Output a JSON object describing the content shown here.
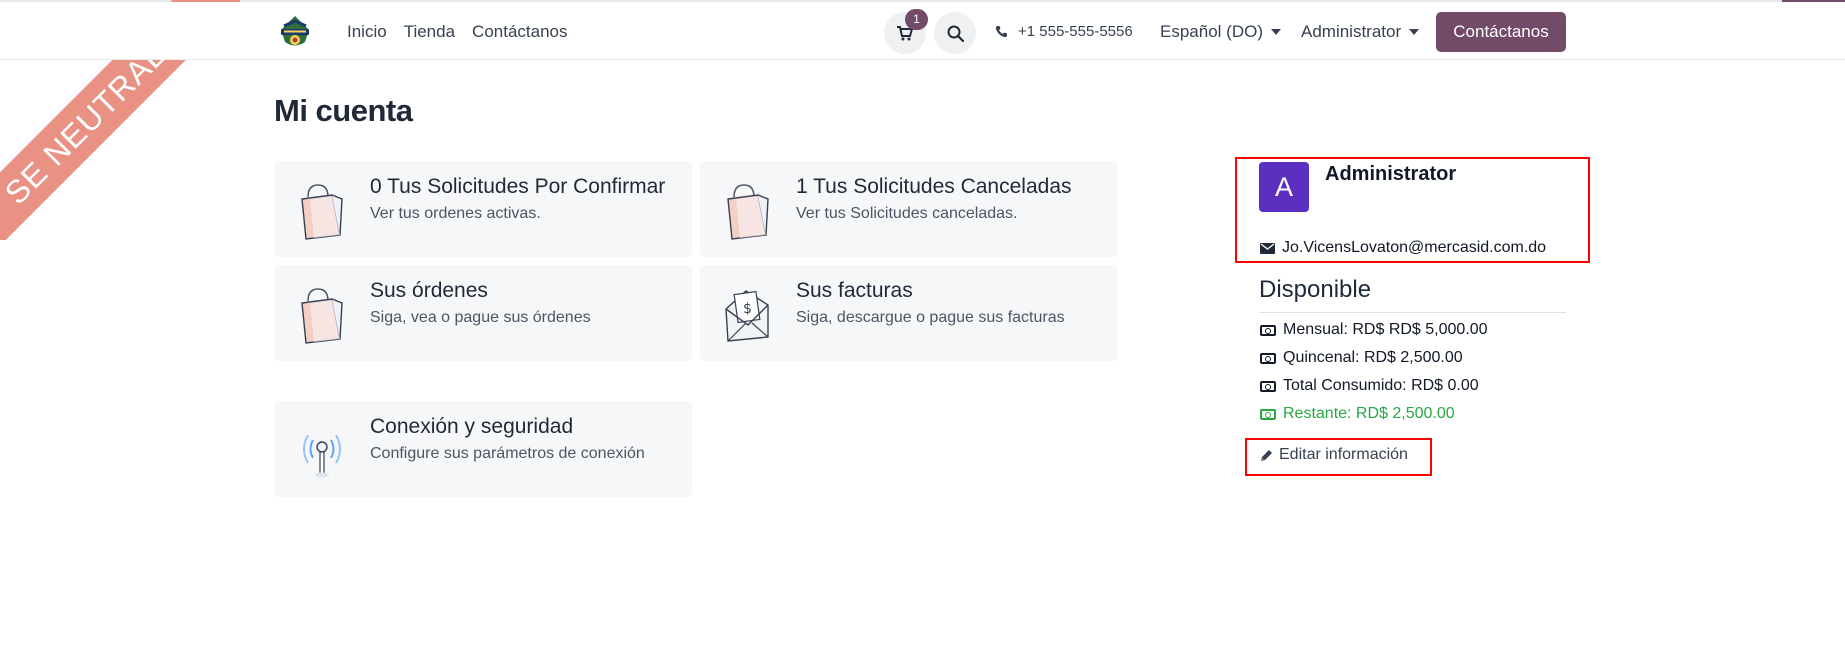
{
  "ribbon": {
    "text": "SE NEUTRALIZÓ"
  },
  "header": {
    "nav": [
      "Inicio",
      "Tienda",
      "Contáctanos"
    ],
    "cart_count": "1",
    "phone": "+1 555-555-5556",
    "language": "Español (DO)",
    "user": "Administrator",
    "cta": "Contáctanos"
  },
  "page": {
    "title": "Mi cuenta"
  },
  "cards": [
    {
      "title": "0  Tus Solicitudes Por Confirmar",
      "subtitle": "Ver tus ordenes activas.",
      "icon": "shopping-bag-icon"
    },
    {
      "title": "1 Tus Solicitudes Canceladas",
      "subtitle": "Ver tus Solicitudes canceladas.",
      "icon": "shopping-bag-icon"
    },
    {
      "title": "Sus órdenes",
      "subtitle": "Siga, vea o pague sus órdenes",
      "icon": "shopping-bag-icon"
    },
    {
      "title": "Sus facturas",
      "subtitle": "Siga, descargue o pague sus facturas",
      "icon": "invoice-envelope-icon"
    },
    {
      "title": "Conexión y seguridad",
      "subtitle": "Configure sus parámetros de conexión",
      "icon": "antenna-icon"
    }
  ],
  "profile": {
    "avatar_letter": "A",
    "name": "Administrator",
    "email": "Jo.VicensLovaton@mercasid.com.do"
  },
  "available": {
    "title": "Disponible",
    "lines": [
      "Mensual: RD$ RD$ 5,000.00",
      "Quincenal: RD$ 2,500.00",
      "Total Consumido: RD$ 0.00",
      "Restante: RD$ 2,500.00"
    ],
    "edit_label": "Editar información"
  },
  "colors": {
    "brand": "#714b67",
    "avatar": "#5b2fc0",
    "remaining": "#28a745",
    "highlight": "#ff0000"
  }
}
